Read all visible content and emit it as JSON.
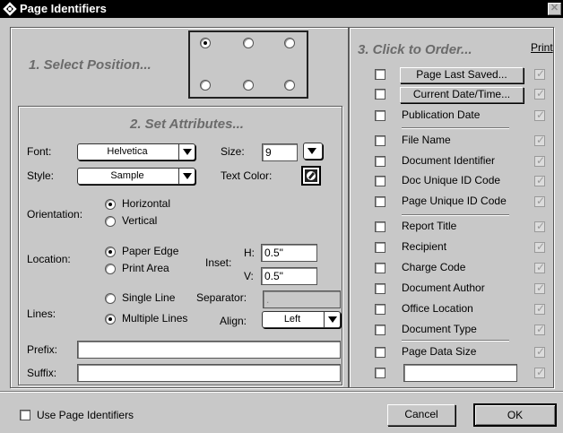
{
  "window": {
    "title": "Page Identifiers",
    "close_glyph": "✕"
  },
  "section1": {
    "heading": "1. Select Position..."
  },
  "section2": {
    "heading": "2. Set Attributes...",
    "font_label": "Font:",
    "font_value": "Helvetica",
    "size_label": "Size:",
    "size_value": "9",
    "style_label": "Style:",
    "style_value": "Sample",
    "text_color_label": "Text Color:",
    "orientation_label": "Orientation:",
    "orientation_options": [
      "Horizontal",
      "Vertical"
    ],
    "location_label": "Location:",
    "location_options": [
      "Paper Edge",
      "Print Area"
    ],
    "inset_label": "Inset:",
    "h_label": "H:",
    "h_value": "0.5\"",
    "v_label": "V:",
    "v_value": "0.5\"",
    "lines_label": "Lines:",
    "lines_options": [
      "Single Line",
      "Multiple Lines"
    ],
    "separator_label": "Separator:",
    "separator_value": ".",
    "align_label": "Align:",
    "align_value": "Left",
    "prefix_label": "Prefix:",
    "prefix_value": "",
    "suffix_label": "Suffix:",
    "suffix_value": ""
  },
  "section3": {
    "heading": "3. Click to Order...",
    "print_label": "Print",
    "items": [
      "Page Last Saved...",
      "Current Date/Time...",
      "Publication Date",
      "File Name",
      "Document Identifier",
      "Doc Unique ID Code",
      "Page Unique ID Code",
      "Report Title",
      "Recipient",
      "Charge Code",
      "Document Author",
      "Office Location",
      "Document Type",
      "Page Data Size",
      ""
    ]
  },
  "footer": {
    "use_label": "Use Page Identifiers",
    "cancel_label": "Cancel",
    "ok_label": "OK"
  },
  "icons": {
    "title": "diamond-app-icon",
    "color": "color-picker-icon"
  },
  "colors": {
    "window_bg": "#c8c8c8",
    "title_bg": "#000000",
    "heading": "#6b6b6b"
  }
}
